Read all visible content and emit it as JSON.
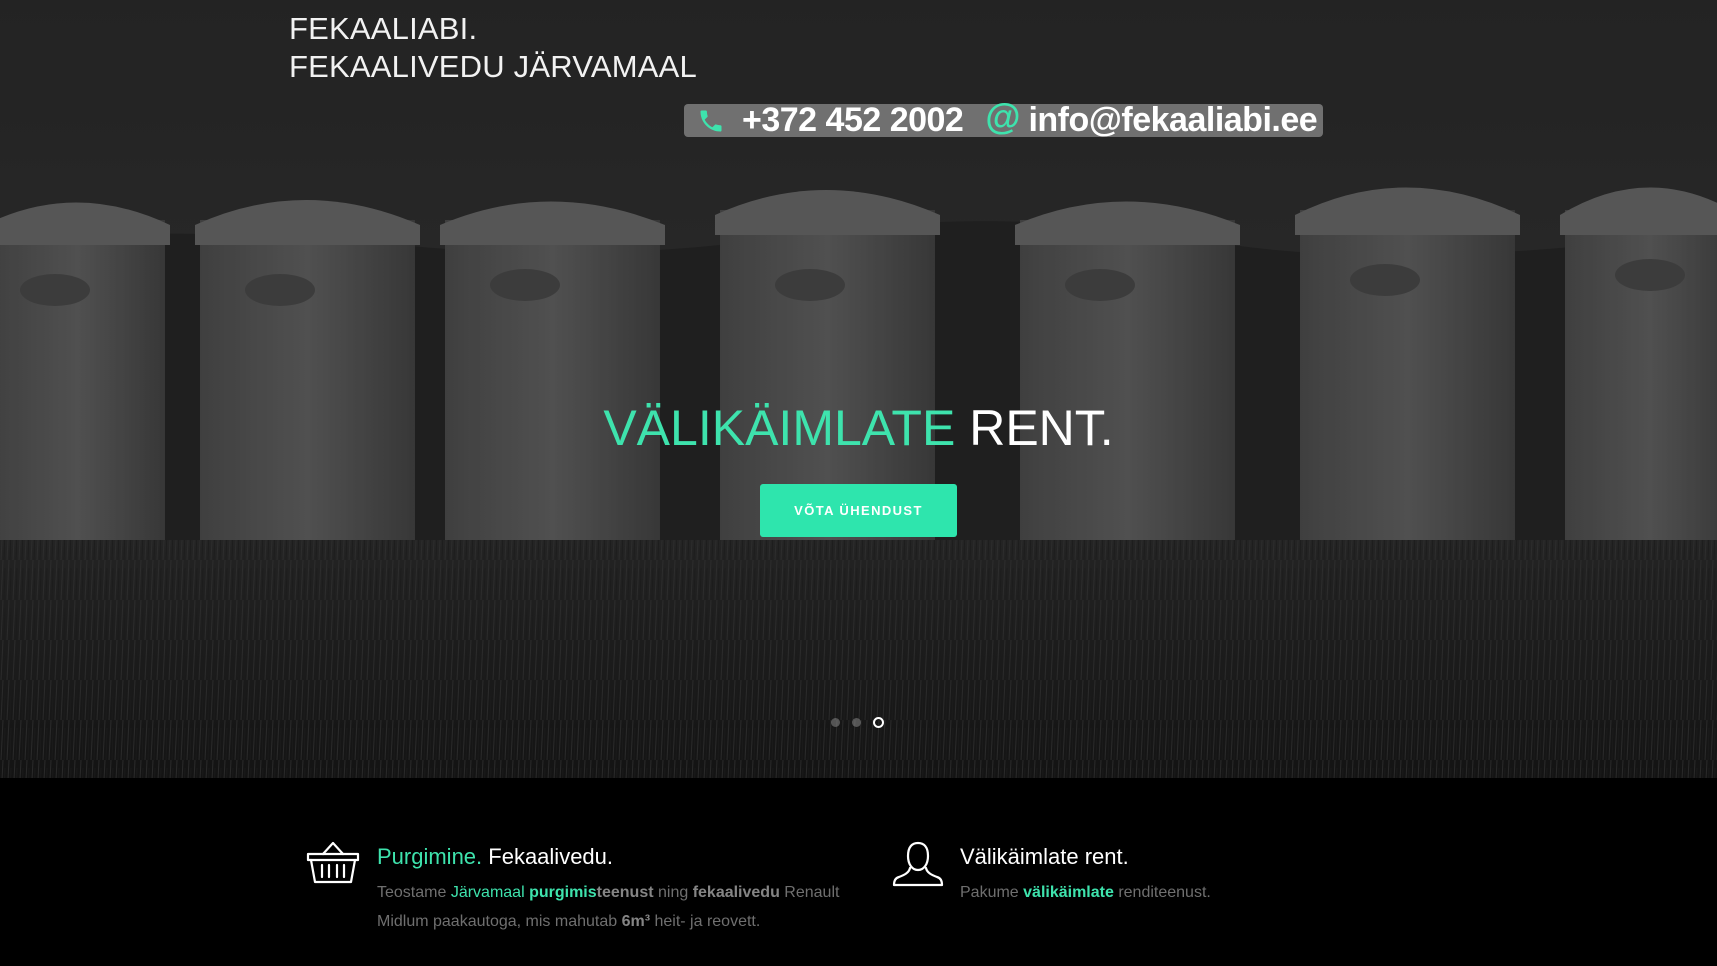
{
  "brand": {
    "line1": "FEKAALIABI.",
    "line2": "FEKAALIVEDU JÄRVAMAAL"
  },
  "contact": {
    "phone_icon": "phone-icon",
    "phone": "+372 452 2002",
    "email_icon": "at-icon",
    "email": "info@fekaaliabi.ee"
  },
  "hero": {
    "headline_accent": "VÄLIKÄIMLATE",
    "headline_rest": " RENT.",
    "cta_label": "VÕTA ÜHENDUST",
    "slider_dots": 3,
    "active_dot": 3
  },
  "features": [
    {
      "icon": "basket-icon",
      "title_accent": "Purgimine.",
      "title_rest": " Fekaalivedu.",
      "text": {
        "p1": "Teostame ",
        "p2": "Järvamaal",
        "p3": " ",
        "p4": "purgimis",
        "p5": "teenust",
        "p6": " ning ",
        "p7": "fekaalivedu",
        "p8": " Renault Midlum paakautoga, mis mahutab ",
        "p9": "6m³",
        "p10": " heit- ja reovett."
      }
    },
    {
      "icon": "user-icon",
      "title": "Välikäimlate rent.",
      "text": {
        "p1": "Pakume ",
        "p2": "välikäimlate",
        "p3": " renditeenust."
      }
    }
  ],
  "colors": {
    "accent": "#3ee3ad",
    "cta": "#2ee5ad",
    "background": "#000000"
  }
}
